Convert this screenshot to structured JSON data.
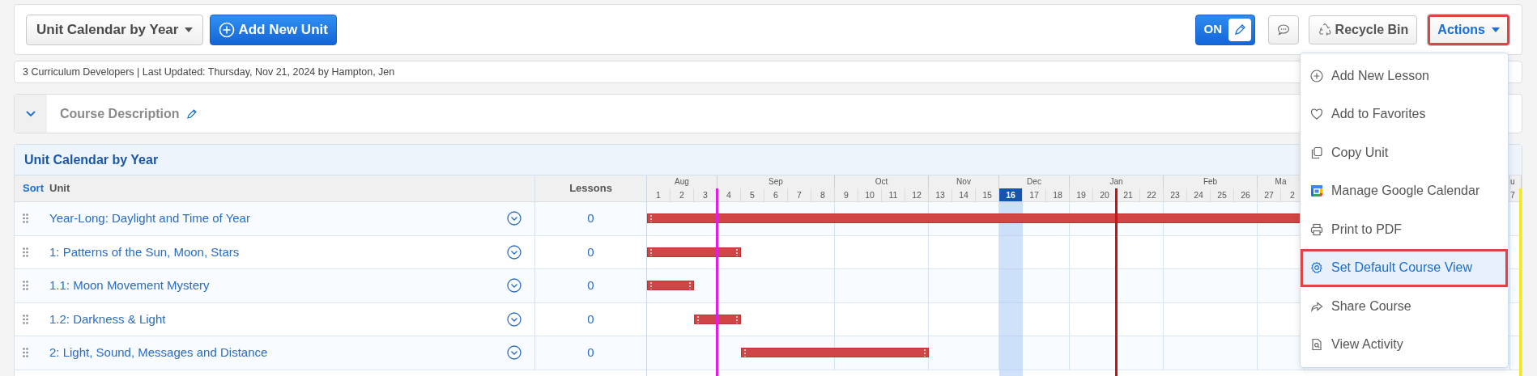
{
  "toolbar": {
    "view_dropdown": "Unit Calendar by Year",
    "add_button": "Add New Unit",
    "edit_toggle": {
      "label": "ON",
      "on": true
    },
    "recycle_button": "Recycle Bin",
    "actions_button": {
      "label": "Actions",
      "highlighted": true
    }
  },
  "info_bar": "3 Curriculum Developers | Last Updated: Thursday, Nov 21, 2024 by Hampton, Jen",
  "course_description": {
    "title": "Course Description"
  },
  "calendar": {
    "title": "Unit Calendar by Year",
    "columns": [
      "Sort",
      "Unit",
      "Lessons"
    ],
    "months": [
      {
        "label": "Aug",
        "weeks": [
          {
            "label": "1",
            "current": false
          },
          {
            "label": "2",
            "current": false
          },
          {
            "label": "3",
            "current": false,
            "color": "#e01ee6"
          }
        ]
      },
      {
        "label": "Sep",
        "weeks": [
          {
            "label": "4",
            "current": false
          },
          {
            "label": "5",
            "current": false
          },
          {
            "label": "6",
            "current": false
          },
          {
            "label": "7",
            "current": false
          },
          {
            "label": "8",
            "current": false
          }
        ]
      },
      {
        "label": "Oct",
        "weeks": [
          {
            "label": "9",
            "current": false
          },
          {
            "label": "10",
            "current": false
          },
          {
            "label": "11",
            "current": false
          },
          {
            "label": "12",
            "current": false
          }
        ]
      },
      {
        "label": "Nov",
        "weeks": [
          {
            "label": "13",
            "current": false
          },
          {
            "label": "14",
            "current": false
          },
          {
            "label": "15",
            "current": false
          }
        ]
      },
      {
        "label": "Dec",
        "weeks": [
          {
            "label": "16",
            "current": true
          },
          {
            "label": "17",
            "current": false
          },
          {
            "label": "18",
            "current": false
          }
        ]
      },
      {
        "label": "Jan",
        "weeks": [
          {
            "label": "19",
            "current": false
          },
          {
            "label": "20",
            "current": false,
            "color": "#d40f0f"
          },
          {
            "label": "21",
            "current": false
          },
          {
            "label": "22",
            "current": false
          }
        ]
      },
      {
        "label": "Feb",
        "weeks": [
          {
            "label": "23",
            "current": false
          },
          {
            "label": "24",
            "current": false
          },
          {
            "label": "25",
            "current": false
          },
          {
            "label": "26",
            "current": false
          }
        ]
      },
      {
        "label": "Ma",
        "weeks": [
          {
            "label": "27",
            "current": false
          },
          {
            "label": "2",
            "current": false
          }
        ]
      },
      {
        "label": "u",
        "weeks": [
          {
            "label": "7",
            "current": false,
            "color": "#f2e829"
          }
        ]
      }
    ],
    "rows": [
      {
        "title": "Year-Long: Daylight and Time of Year",
        "lessons": "0",
        "segments": [
          {
            "kind": "bar",
            "level": 1
          }
        ]
      },
      {
        "title": "1: Patterns of the Sun, Moon, Stars",
        "lessons": "0",
        "segments": [
          {
            "kind": "bar",
            "level": 0.1429
          }
        ]
      },
      {
        "title": "1.1: Moon Movement Mystery",
        "lessons": "0",
        "segments": [
          {
            "kind": "bar",
            "level": 0.0714
          }
        ]
      },
      {
        "title": "1.2: Darkness & Light",
        "lessons": "0",
        "segments": [
          {
            "kind": "gap",
            "level": 0.0714
          },
          {
            "kind": "bar",
            "level": 0.0714
          }
        ]
      },
      {
        "title": "2: Light, Sound, Messages and Distance",
        "lessons": "0",
        "segments": [
          {
            "kind": "gap",
            "level": 0.1429
          },
          {
            "kind": "bar",
            "level": 0.2857
          }
        ]
      }
    ]
  },
  "actions_menu": {
    "items": [
      {
        "label": "Add New Lesson",
        "highlighted": false
      },
      {
        "label": "Add to Favorites",
        "highlighted": false
      },
      {
        "label": "Copy Unit",
        "highlighted": false
      },
      {
        "label": "Manage Google Calendar",
        "highlighted": false
      },
      {
        "label": "Print to PDF",
        "highlighted": false
      },
      {
        "label": "Set Default Course View",
        "highlighted": true
      },
      {
        "label": "Share Course",
        "highlighted": false
      },
      {
        "label": "View Activity",
        "highlighted": false
      }
    ]
  }
}
